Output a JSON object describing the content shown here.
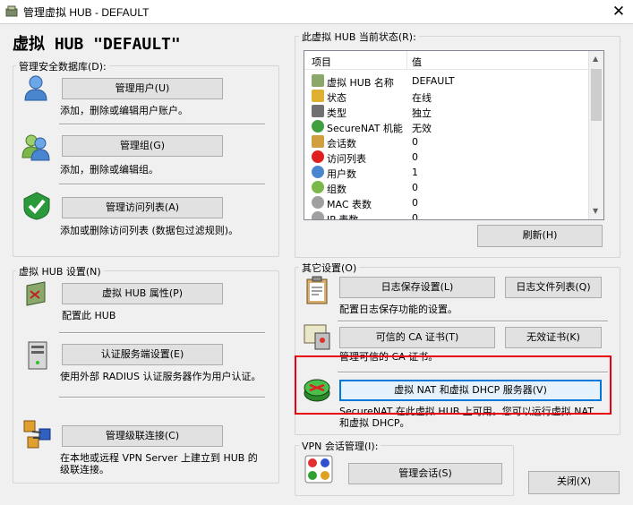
{
  "window": {
    "title": "管理虚拟 HUB - DEFAULT",
    "close": "✕"
  },
  "hub_title": "虚拟 HUB \"DEFAULT\"",
  "security_db": {
    "legend": "管理安全数据库(D):",
    "manage_users": {
      "label": "管理用户(U)",
      "desc": "添加，删除或编辑用户账户。"
    },
    "manage_groups": {
      "label": "管理组(G)",
      "desc": "添加，删除或编辑组。"
    },
    "manage_access": {
      "label": "管理访问列表(A)",
      "desc": "添加或删除访问列表 (数据包过滤规则)。"
    }
  },
  "hub_settings": {
    "legend": "虚拟 HUB 设置(N)",
    "properties": {
      "label": "虚拟 HUB 属性(P)",
      "desc": "配置此 HUB"
    },
    "radius": {
      "label": "认证服务端设置(E)",
      "desc": "使用外部 RADIUS 认证服务器作为用户认证。"
    },
    "cascade": {
      "label": "管理级联连接(C)",
      "desc": "在本地或远程 VPN Server 上建立到 HUB 的级联连接。"
    }
  },
  "status": {
    "legend": "此虚拟 HUB 当前状态(R):",
    "col_item": "项目",
    "col_value": "值",
    "rows": [
      {
        "k": "虚拟 HUB 名称",
        "v": "DEFAULT",
        "icon": "hub-icon"
      },
      {
        "k": "状态",
        "v": "在线",
        "icon": "status-icon"
      },
      {
        "k": "类型",
        "v": "独立",
        "icon": "server-icon"
      },
      {
        "k": "SecureNAT 机能",
        "v": "无效",
        "icon": "router-icon"
      },
      {
        "k": "会话数",
        "v": "0",
        "icon": "session-icon"
      },
      {
        "k": "访问列表",
        "v": "0",
        "icon": "access-icon"
      },
      {
        "k": "用户数",
        "v": "1",
        "icon": "user-icon"
      },
      {
        "k": "组数",
        "v": "0",
        "icon": "group-icon"
      },
      {
        "k": "MAC 表数",
        "v": "0",
        "icon": "mac-icon"
      },
      {
        "k": "IP 表数",
        "v": "0",
        "icon": "ip-icon"
      }
    ],
    "refresh": "刷新(H)"
  },
  "other": {
    "legend": "其它设置(O)",
    "log_settings": "日志保存设置(L)",
    "log_files": "日志文件列表(Q)",
    "log_desc": "配置日志保存功能的设置。",
    "trusted_ca": "可信的 CA 证书(T)",
    "invalid_cert": "无效证书(K)",
    "ca_desc": "管理可信的 CA 证书。",
    "nat_dhcp": "虚拟 NAT 和虚拟 DHCP 服务器(V)",
    "nat_desc": "SecureNAT 在此虚拟 HUB 上可用。您可以运行虚拟 NAT 和虚拟 DHCP。"
  },
  "vpn_sessions": {
    "legend": "VPN 会话管理(I):",
    "manage": "管理会话(S)"
  },
  "close_button": "关闭(X)"
}
